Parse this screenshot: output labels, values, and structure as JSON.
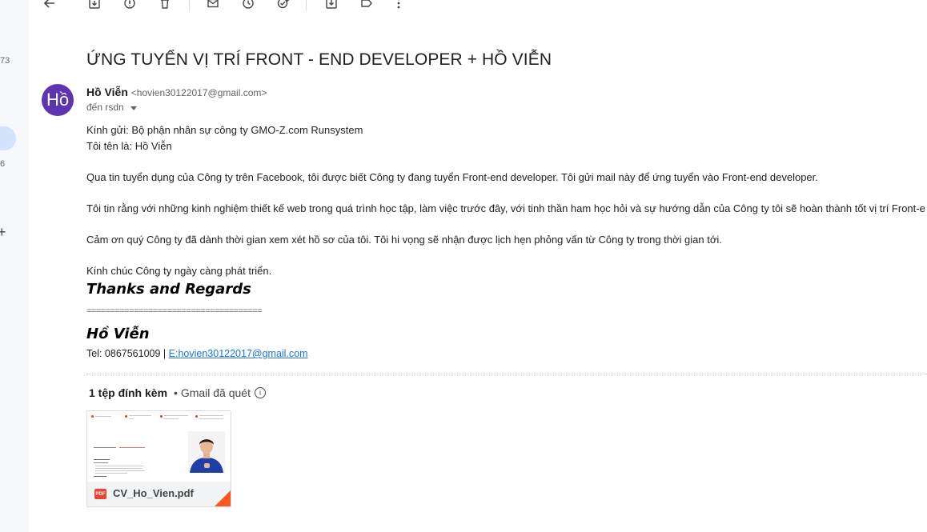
{
  "left_rail": {
    "label_top": "73",
    "label_mid": "6",
    "plus": "+"
  },
  "toolbar": {
    "icons": [
      "back-icon",
      "archive-icon",
      "report-spam-icon",
      "delete-icon",
      "mark-unread-icon",
      "snooze-icon",
      "add-task-icon",
      "move-to-icon",
      "label-icon",
      "more-icon"
    ]
  },
  "email": {
    "subject": "ỨNG TUYỂN VỊ TRÍ FRONT - END DEVELOPER + HỒ VIỄN",
    "avatar_text": "Hồ",
    "avatar_color": "#5e35b1",
    "sender_name": "Hồ Viễn",
    "sender_email": "<hovien30122017@gmail.com>",
    "recipient": "đến rsdn",
    "body": {
      "greeting": "Kính gửi: Bộ phận nhân sự công ty GMO-Z.com Runsystem",
      "intro": "Tôi tên là: Hồ Viễn",
      "para1": "Qua tin tuyển dụng của Công ty trên Facebook, tôi được biết Công ty đang tuyển  Front-end developer. Tôi gửi mail này để ứng tuyển vào  Front-end  developer.",
      "para2": "Tôi tin rằng với những kinh nghiệm thiết kế web trong quá trình học tập, làm việc trước đây, với tinh thần ham học hỏi và sự hướng dẫn của Công ty tôi sẽ hoàn thành tốt vị trí  Front-e",
      "para3": "Cảm ơn quý Công ty đã dành thời gian xem xét hồ sơ của tôi. Tôi hi vọng sẽ nhận được lịch hẹn phỏng vấn từ Công ty trong thời gian tới.",
      "closing": "Kính chúc Công ty ngày càng phát triển."
    },
    "signature": {
      "thanks": "Thanks and Regards",
      "line": "=====================================",
      "name": "Hồ Viễn",
      "tel_prefix": "Tel: 0867561009 | ",
      "email_link": "E:hovien30122017@gmail.com"
    }
  },
  "attachments": {
    "count_label": "1 tệp đính kèm",
    "scan_label": "• Gmail đã quét",
    "info_glyph": "i",
    "file": {
      "badge": "PDF",
      "name": "CV_Ho_Vien.pdf"
    }
  },
  "colors": {
    "accent": "#1a73e8",
    "pdf_red": "#ea4335",
    "corner_orange": "#ff5722"
  }
}
